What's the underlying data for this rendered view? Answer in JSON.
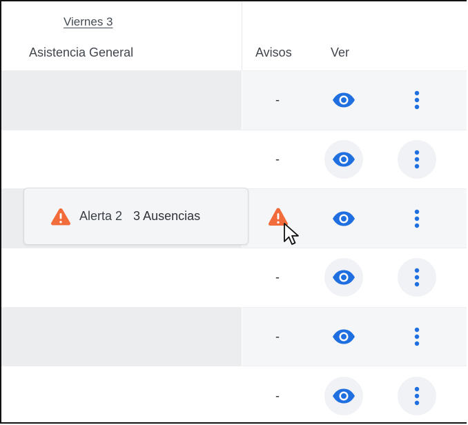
{
  "header": {
    "day_link": "Viernes 3",
    "columns": {
      "general": "Asistencia General",
      "avisos": "Avisos",
      "ver": "Ver"
    }
  },
  "rows": [
    {
      "aviso": "-",
      "has_alert": false
    },
    {
      "aviso": "-",
      "has_alert": false
    },
    {
      "aviso": "",
      "has_alert": true
    },
    {
      "aviso": "-",
      "has_alert": false
    },
    {
      "aviso": "-",
      "has_alert": false
    },
    {
      "aviso": "-",
      "has_alert": false
    }
  ],
  "tooltip": {
    "alert_label": "Alerta 2",
    "absences_label": "3 Ausencias"
  },
  "icons": {
    "view": "eye-icon",
    "more": "more-vertical-icon",
    "warning": "warning-triangle-icon",
    "cursor": "mouse-pointer-icon"
  },
  "colors": {
    "primary_blue": "#1f6fe0",
    "warning_orange": "#f26b3a",
    "row_shade": "#ecedee",
    "header_text": "#41464d"
  }
}
